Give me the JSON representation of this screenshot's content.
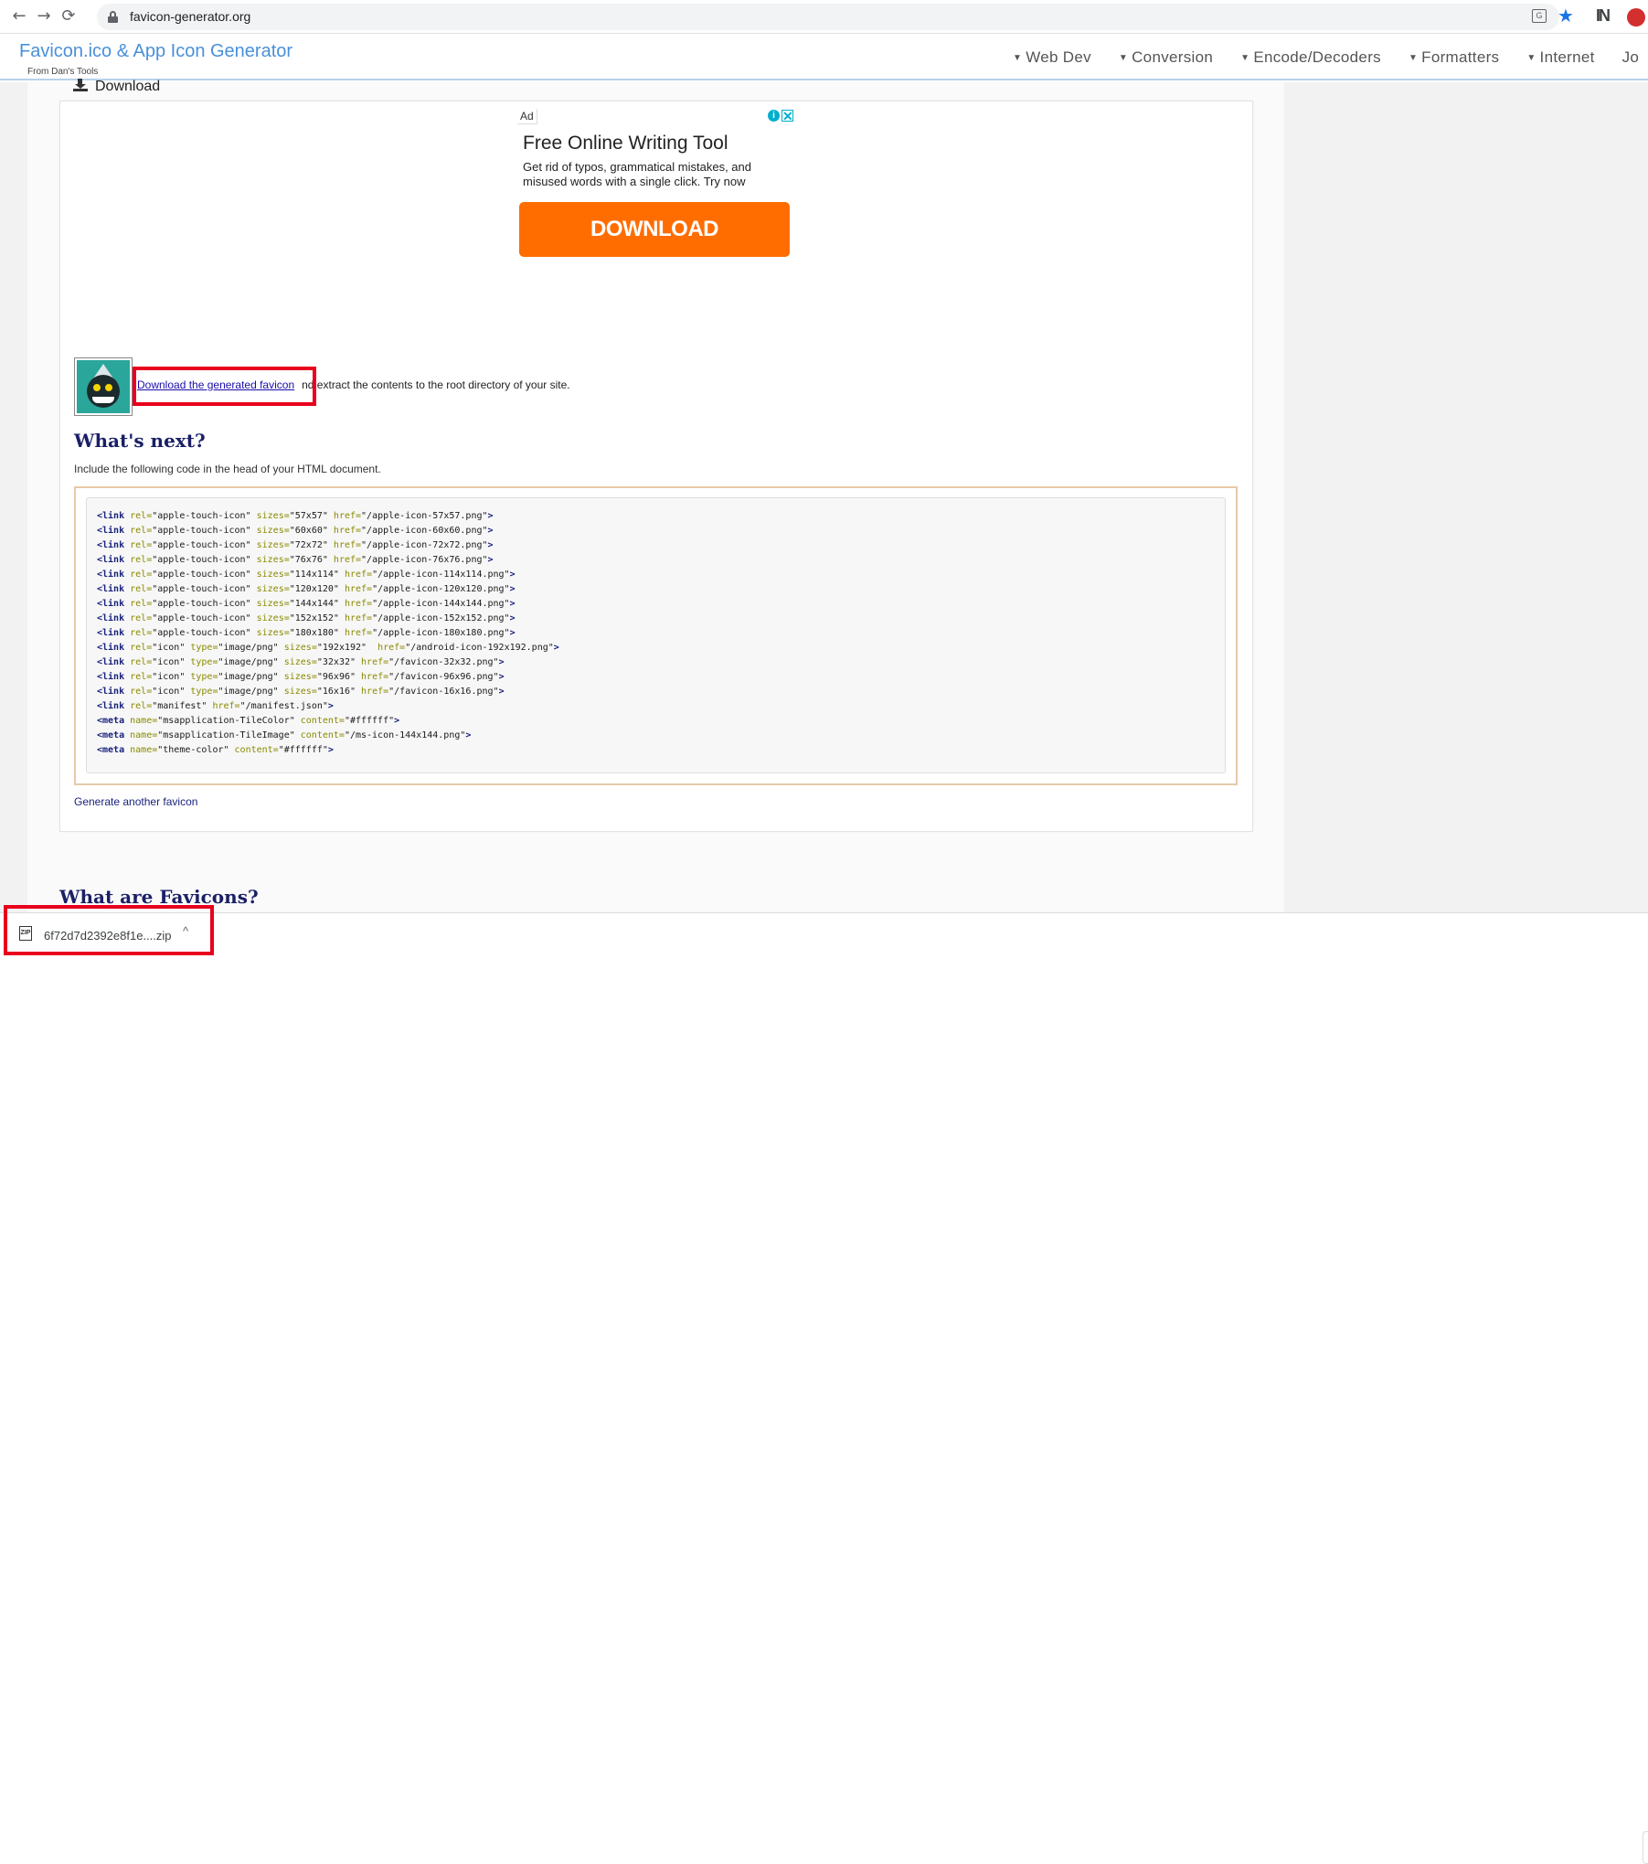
{
  "browser": {
    "url": "favicon-generator.org",
    "back_glyph": "←",
    "forward_glyph": "→",
    "reload_glyph": "⟳",
    "star_glyph": "★",
    "n_glyph": "IN",
    "icons": [
      "back-icon",
      "forward-icon",
      "reload-icon",
      "lock-icon",
      "translate-icon",
      "star-icon",
      "extension-icon",
      "profile-icon"
    ]
  },
  "site": {
    "title": "Favicon.ico & App Icon Generator",
    "subtitle": "From Dan's Tools",
    "nav": [
      "Web Dev",
      "Conversion",
      "Encode/Decoders",
      "Formatters",
      "Internet",
      "Jo"
    ]
  },
  "page": {
    "download_tab": "Download",
    "ad": {
      "label": "Ad",
      "info": "i",
      "close": "✕",
      "headline": "Free Online Writing Tool",
      "body": "Get rid of typos, grammatical mistakes, and misused words with a single click. Try now",
      "cta": "DOWNLOAD"
    },
    "download_link": "Download the generated favicon",
    "download_rest": "nd extract the contents to the root directory of your site.",
    "whats_next": "What's next?",
    "include_text": "Include the following code in the head of your HTML document.",
    "code_lines": [
      [
        [
          "<link",
          "tag"
        ],
        [
          " rel=",
          "attr"
        ],
        [
          "\"apple-touch-icon\"",
          "val"
        ],
        [
          " sizes=",
          "attr"
        ],
        [
          "\"57x57\"",
          "val"
        ],
        [
          " href=",
          "attr"
        ],
        [
          "\"/apple-icon-57x57.png\"",
          "val"
        ],
        [
          ">",
          "tag"
        ]
      ],
      [
        [
          "<link",
          "tag"
        ],
        [
          " rel=",
          "attr"
        ],
        [
          "\"apple-touch-icon\"",
          "val"
        ],
        [
          " sizes=",
          "attr"
        ],
        [
          "\"60x60\"",
          "val"
        ],
        [
          " href=",
          "attr"
        ],
        [
          "\"/apple-icon-60x60.png\"",
          "val"
        ],
        [
          ">",
          "tag"
        ]
      ],
      [
        [
          "<link",
          "tag"
        ],
        [
          " rel=",
          "attr"
        ],
        [
          "\"apple-touch-icon\"",
          "val"
        ],
        [
          " sizes=",
          "attr"
        ],
        [
          "\"72x72\"",
          "val"
        ],
        [
          " href=",
          "attr"
        ],
        [
          "\"/apple-icon-72x72.png\"",
          "val"
        ],
        [
          ">",
          "tag"
        ]
      ],
      [
        [
          "<link",
          "tag"
        ],
        [
          " rel=",
          "attr"
        ],
        [
          "\"apple-touch-icon\"",
          "val"
        ],
        [
          " sizes=",
          "attr"
        ],
        [
          "\"76x76\"",
          "val"
        ],
        [
          " href=",
          "attr"
        ],
        [
          "\"/apple-icon-76x76.png\"",
          "val"
        ],
        [
          ">",
          "tag"
        ]
      ],
      [
        [
          "<link",
          "tag"
        ],
        [
          " rel=",
          "attr"
        ],
        [
          "\"apple-touch-icon\"",
          "val"
        ],
        [
          " sizes=",
          "attr"
        ],
        [
          "\"114x114\"",
          "val"
        ],
        [
          " href=",
          "attr"
        ],
        [
          "\"/apple-icon-114x114.png\"",
          "val"
        ],
        [
          ">",
          "tag"
        ]
      ],
      [
        [
          "<link",
          "tag"
        ],
        [
          " rel=",
          "attr"
        ],
        [
          "\"apple-touch-icon\"",
          "val"
        ],
        [
          " sizes=",
          "attr"
        ],
        [
          "\"120x120\"",
          "val"
        ],
        [
          " href=",
          "attr"
        ],
        [
          "\"/apple-icon-120x120.png\"",
          "val"
        ],
        [
          ">",
          "tag"
        ]
      ],
      [
        [
          "<link",
          "tag"
        ],
        [
          " rel=",
          "attr"
        ],
        [
          "\"apple-touch-icon\"",
          "val"
        ],
        [
          " sizes=",
          "attr"
        ],
        [
          "\"144x144\"",
          "val"
        ],
        [
          " href=",
          "attr"
        ],
        [
          "\"/apple-icon-144x144.png\"",
          "val"
        ],
        [
          ">",
          "tag"
        ]
      ],
      [
        [
          "<link",
          "tag"
        ],
        [
          " rel=",
          "attr"
        ],
        [
          "\"apple-touch-icon\"",
          "val"
        ],
        [
          " sizes=",
          "attr"
        ],
        [
          "\"152x152\"",
          "val"
        ],
        [
          " href=",
          "attr"
        ],
        [
          "\"/apple-icon-152x152.png\"",
          "val"
        ],
        [
          ">",
          "tag"
        ]
      ],
      [
        [
          "<link",
          "tag"
        ],
        [
          " rel=",
          "attr"
        ],
        [
          "\"apple-touch-icon\"",
          "val"
        ],
        [
          " sizes=",
          "attr"
        ],
        [
          "\"180x180\"",
          "val"
        ],
        [
          " href=",
          "attr"
        ],
        [
          "\"/apple-icon-180x180.png\"",
          "val"
        ],
        [
          ">",
          "tag"
        ]
      ],
      [
        [
          "<link",
          "tag"
        ],
        [
          " rel=",
          "attr"
        ],
        [
          "\"icon\"",
          "val"
        ],
        [
          " type=",
          "attr"
        ],
        [
          "\"image/png\"",
          "val"
        ],
        [
          " sizes=",
          "attr"
        ],
        [
          "\"192x192\"",
          "val"
        ],
        [
          "  href=",
          "attr"
        ],
        [
          "\"/android-icon-192x192.png\"",
          "val"
        ],
        [
          ">",
          "tag"
        ]
      ],
      [
        [
          "<link",
          "tag"
        ],
        [
          " rel=",
          "attr"
        ],
        [
          "\"icon\"",
          "val"
        ],
        [
          " type=",
          "attr"
        ],
        [
          "\"image/png\"",
          "val"
        ],
        [
          " sizes=",
          "attr"
        ],
        [
          "\"32x32\"",
          "val"
        ],
        [
          " href=",
          "attr"
        ],
        [
          "\"/favicon-32x32.png\"",
          "val"
        ],
        [
          ">",
          "tag"
        ]
      ],
      [
        [
          "<link",
          "tag"
        ],
        [
          " rel=",
          "attr"
        ],
        [
          "\"icon\"",
          "val"
        ],
        [
          " type=",
          "attr"
        ],
        [
          "\"image/png\"",
          "val"
        ],
        [
          " sizes=",
          "attr"
        ],
        [
          "\"96x96\"",
          "val"
        ],
        [
          " href=",
          "attr"
        ],
        [
          "\"/favicon-96x96.png\"",
          "val"
        ],
        [
          ">",
          "tag"
        ]
      ],
      [
        [
          "<link",
          "tag"
        ],
        [
          " rel=",
          "attr"
        ],
        [
          "\"icon\"",
          "val"
        ],
        [
          " type=",
          "attr"
        ],
        [
          "\"image/png\"",
          "val"
        ],
        [
          " sizes=",
          "attr"
        ],
        [
          "\"16x16\"",
          "val"
        ],
        [
          " href=",
          "attr"
        ],
        [
          "\"/favicon-16x16.png\"",
          "val"
        ],
        [
          ">",
          "tag"
        ]
      ],
      [
        [
          "<link",
          "tag"
        ],
        [
          " rel=",
          "attr"
        ],
        [
          "\"manifest\"",
          "val"
        ],
        [
          " href=",
          "attr"
        ],
        [
          "\"/manifest.json\"",
          "val"
        ],
        [
          ">",
          "tag"
        ]
      ],
      [
        [
          "<meta",
          "tag"
        ],
        [
          " name=",
          "attr"
        ],
        [
          "\"msapplication-TileColor\"",
          "val"
        ],
        [
          " content=",
          "attr"
        ],
        [
          "\"#ffffff\"",
          "val"
        ],
        [
          ">",
          "tag"
        ]
      ],
      [
        [
          "<meta",
          "tag"
        ],
        [
          " name=",
          "attr"
        ],
        [
          "\"msapplication-TileImage\"",
          "val"
        ],
        [
          " content=",
          "attr"
        ],
        [
          "\"/ms-icon-144x144.png\"",
          "val"
        ],
        [
          ">",
          "tag"
        ]
      ],
      [
        [
          "<meta",
          "tag"
        ],
        [
          " name=",
          "attr"
        ],
        [
          "\"theme-color\"",
          "val"
        ],
        [
          " content=",
          "attr"
        ],
        [
          "\"#ffffff\"",
          "val"
        ],
        [
          ">",
          "tag"
        ]
      ]
    ],
    "generate_another": "Generate another favicon",
    "what_are_favicons": "What are Favicons?"
  },
  "download_shelf": {
    "file_name": "6f72d7d2392e8f1e....zip",
    "zip_label": "ZIP",
    "chevron": "^"
  },
  "colors": {
    "highlight": "#e8001c",
    "site_title": "#4a90d9",
    "ad_cta": "#ff6d00",
    "heading": "#1a1f66"
  }
}
